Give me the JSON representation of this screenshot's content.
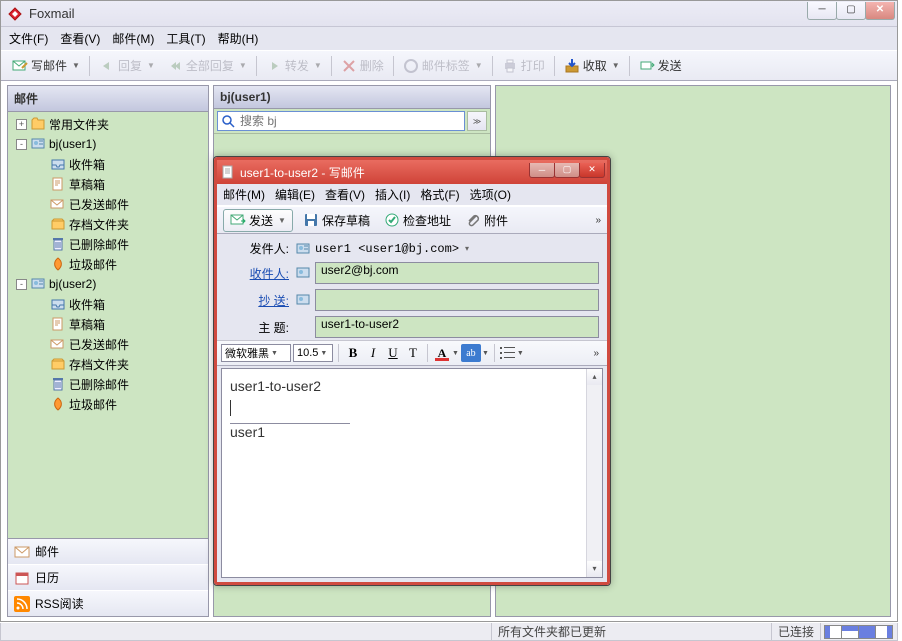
{
  "app": {
    "title": "Foxmail"
  },
  "menu": [
    "文件(F)",
    "查看(V)",
    "邮件(M)",
    "工具(T)",
    "帮助(H)"
  ],
  "toolbar": {
    "compose": "写邮件",
    "reply": "回复",
    "reply_all": "全部回复",
    "forward": "转发",
    "delete": "删除",
    "tags": "邮件标签",
    "print": "打印",
    "receive": "收取",
    "send": "发送"
  },
  "sidebar": {
    "header": "邮件",
    "nodes": [
      {
        "kind": "acc",
        "expand": "+",
        "label": "常用文件夹"
      },
      {
        "kind": "acc",
        "expand": "-",
        "label": "bj(user1)"
      },
      {
        "kind": "leaf",
        "icon": "inbox",
        "label": "收件箱"
      },
      {
        "kind": "leaf",
        "icon": "drafts",
        "label": "草稿箱"
      },
      {
        "kind": "leaf",
        "icon": "sent",
        "label": "已发送邮件"
      },
      {
        "kind": "leaf",
        "icon": "archive",
        "label": "存档文件夹"
      },
      {
        "kind": "leaf",
        "icon": "deleted",
        "label": "已删除邮件"
      },
      {
        "kind": "leaf",
        "icon": "junk",
        "label": "垃圾邮件"
      },
      {
        "kind": "acc",
        "expand": "-",
        "label": "bj(user2)"
      },
      {
        "kind": "leaf",
        "icon": "inbox",
        "label": "收件箱"
      },
      {
        "kind": "leaf",
        "icon": "drafts",
        "label": "草稿箱"
      },
      {
        "kind": "leaf",
        "icon": "sent",
        "label": "已发送邮件"
      },
      {
        "kind": "leaf",
        "icon": "archive",
        "label": "存档文件夹"
      },
      {
        "kind": "leaf",
        "icon": "deleted",
        "label": "已删除邮件"
      },
      {
        "kind": "leaf",
        "icon": "junk",
        "label": "垃圾邮件"
      }
    ],
    "tabs": [
      "邮件",
      "日历",
      "RSS阅读"
    ]
  },
  "list": {
    "header": "bj(user1)",
    "search_placeholder": "搜索 bj"
  },
  "status": {
    "msg": "所有文件夹都已更新",
    "conn": "已连接"
  },
  "compose": {
    "title": "user1-to-user2 - 写邮件",
    "menu": [
      "邮件(M)",
      "编辑(E)",
      "查看(V)",
      "插入(I)",
      "格式(F)",
      "选项(O)"
    ],
    "toolbar": {
      "send": "发送",
      "save": "保存草稿",
      "check": "检查地址",
      "attach": "附件"
    },
    "labels": {
      "from": "发件人:",
      "to": "收件人:",
      "cc": "抄  送:",
      "subject": "主  题:"
    },
    "from": "user1 <user1@bj.com>",
    "to": "user2@bj.com",
    "cc": "",
    "subject": "user1-to-user2",
    "font": "微软雅黑",
    "size": "10.5",
    "body_line1": "user1-to-user2",
    "body_sig": "user1"
  }
}
